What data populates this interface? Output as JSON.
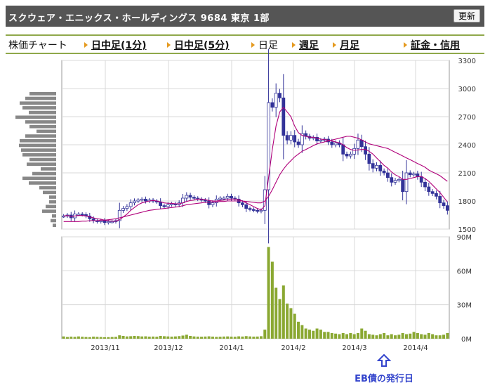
{
  "header": {
    "title": "スクウェア・エニックス・ホールディングス  9684  東京 1部",
    "refresh_label": "更新"
  },
  "nav": {
    "label": "株価チャート",
    "intraday_1": "日中足(1分)",
    "intraday_5": "日中足(5分)",
    "daily": "日足",
    "weekly": "週足",
    "monthly": "月足",
    "margin": "証金・信用"
  },
  "annotation": {
    "label": "EB債の発行日",
    "arrow_color": "#3344cc"
  },
  "colors": {
    "ma_short": "#b0007a",
    "ma_long": "#b0007a",
    "candle": "#333399",
    "volume_bar": "#8aa832",
    "profile_bar": "#888888",
    "grid": "#d8d8d8"
  },
  "chart_data": [
    {
      "type": "candlestick",
      "title": "",
      "y_ticks": [
        1500,
        1800,
        2100,
        2400,
        2700,
        3000,
        3300
      ],
      "ylim": [
        1500,
        3300
      ],
      "x_ticks": [
        "2013/11",
        "2013/12",
        "2014/1",
        "2014/2",
        "2014/3",
        "2014/4"
      ],
      "close": [
        1640,
        1650,
        1620,
        1660,
        1660,
        1655,
        1640,
        1610,
        1590,
        1580,
        1590,
        1570,
        1580,
        1580,
        1590,
        1700,
        1720,
        1740,
        1780,
        1800,
        1810,
        1820,
        1800,
        1810,
        1800,
        1790,
        1750,
        1740,
        1760,
        1770,
        1760,
        1780,
        1830,
        1860,
        1840,
        1830,
        1820,
        1810,
        1800,
        1760,
        1780,
        1820,
        1830,
        1830,
        1850,
        1830,
        1820,
        1780,
        1760,
        1720,
        1710,
        1700,
        1690,
        1700,
        1920,
        2850,
        2800,
        2950,
        2900,
        2500,
        2450,
        2500,
        2430,
        2400,
        2520,
        2490,
        2470,
        2480,
        2440,
        2450,
        2460,
        2430,
        2400,
        2420,
        2400,
        2300,
        2280,
        2300,
        2360,
        2450,
        2380,
        2300,
        2200,
        2150,
        2180,
        2120,
        2100,
        2050,
        2000,
        2020,
        2030,
        1900,
        2100,
        2080,
        2090,
        2060,
        2000,
        1950,
        1900,
        1880,
        1850,
        1780,
        1750,
        1700
      ],
      "ma_short": [
        1640,
        1645,
        1635,
        1640,
        1645,
        1645,
        1640,
        1630,
        1620,
        1610,
        1605,
        1595,
        1590,
        1585,
        1585,
        1600,
        1630,
        1660,
        1700,
        1730,
        1760,
        1780,
        1790,
        1800,
        1805,
        1800,
        1790,
        1780,
        1775,
        1775,
        1770,
        1770,
        1780,
        1795,
        1805,
        1810,
        1820,
        1820,
        1815,
        1805,
        1800,
        1800,
        1805,
        1810,
        1815,
        1820,
        1820,
        1815,
        1800,
        1780,
        1760,
        1740,
        1720,
        1705,
        1750,
        2050,
        2350,
        2600,
        2750,
        2800,
        2750,
        2700,
        2600,
        2530,
        2500,
        2490,
        2480,
        2480,
        2470,
        2460,
        2455,
        2450,
        2440,
        2430,
        2420,
        2400,
        2370,
        2350,
        2340,
        2345,
        2350,
        2350,
        2330,
        2300,
        2260,
        2220,
        2180,
        2150,
        2110,
        2080,
        2060,
        2030,
        2030,
        2040,
        2050,
        2060,
        2060,
        2040,
        2010,
        1970,
        1930,
        1890,
        1840,
        1790
      ],
      "ma_long": [
        1580,
        1580,
        1580,
        1580,
        1580,
        1585,
        1585,
        1590,
        1590,
        1590,
        1595,
        1595,
        1600,
        1605,
        1610,
        1620,
        1630,
        1640,
        1650,
        1660,
        1670,
        1680,
        1690,
        1700,
        1705,
        1710,
        1715,
        1720,
        1725,
        1730,
        1735,
        1740,
        1750,
        1760,
        1765,
        1770,
        1775,
        1780,
        1785,
        1785,
        1790,
        1790,
        1795,
        1795,
        1800,
        1800,
        1800,
        1800,
        1800,
        1795,
        1790,
        1785,
        1780,
        1780,
        1800,
        1850,
        1920,
        2000,
        2080,
        2140,
        2190,
        2230,
        2270,
        2300,
        2330,
        2350,
        2370,
        2390,
        2410,
        2420,
        2430,
        2440,
        2450,
        2460,
        2470,
        2480,
        2490,
        2490,
        2480,
        2470,
        2450,
        2430,
        2410,
        2400,
        2390,
        2380,
        2370,
        2360,
        2340,
        2320,
        2300,
        2280,
        2260,
        2240,
        2220,
        2200,
        2180,
        2160,
        2130,
        2110,
        2090,
        2070,
        2040,
        2010
      ]
    },
    {
      "type": "bar",
      "title": "",
      "y_ticks": [
        "0M",
        "30M",
        "60M",
        "90M"
      ],
      "ylim": [
        0,
        90
      ],
      "values": [
        2,
        1.5,
        1.8,
        1.6,
        2,
        1.7,
        1.5,
        1.4,
        1.8,
        1.6,
        1.5,
        1.3,
        1.4,
        1.5,
        1.6,
        3,
        2.5,
        2,
        2.2,
        2.5,
        2.3,
        2,
        2.1,
        1.8,
        1.9,
        1.7,
        2.5,
        2.2,
        2,
        1.8,
        2,
        2.3,
        2.8,
        3.5,
        2.5,
        2,
        1.8,
        1.7,
        1.9,
        2.1,
        1.8,
        1.6,
        1.7,
        1.9,
        2,
        1.8,
        1.7,
        2.1,
        1.9,
        2.3,
        2,
        1.8,
        1.9,
        2.2,
        8,
        81,
        68,
        45,
        35,
        47,
        31,
        27,
        22,
        15,
        12,
        9,
        8,
        7,
        9,
        8,
        6,
        6,
        5,
        4.5,
        4,
        5,
        4,
        5,
        4,
        5,
        9,
        7,
        4,
        3.5,
        3,
        4,
        5,
        3,
        4,
        3,
        3.5,
        5,
        4,
        4.5,
        6,
        5,
        4,
        3.5,
        5,
        4,
        3,
        3,
        3.5,
        5
      ]
    }
  ],
  "volume_profile": [
    38,
    44,
    52,
    48,
    39,
    58,
    44,
    38,
    28,
    44,
    52,
    53,
    50,
    48,
    38,
    42,
    22,
    34,
    48,
    39,
    24,
    19,
    10,
    10,
    15,
    20,
    6,
    8,
    5
  ]
}
